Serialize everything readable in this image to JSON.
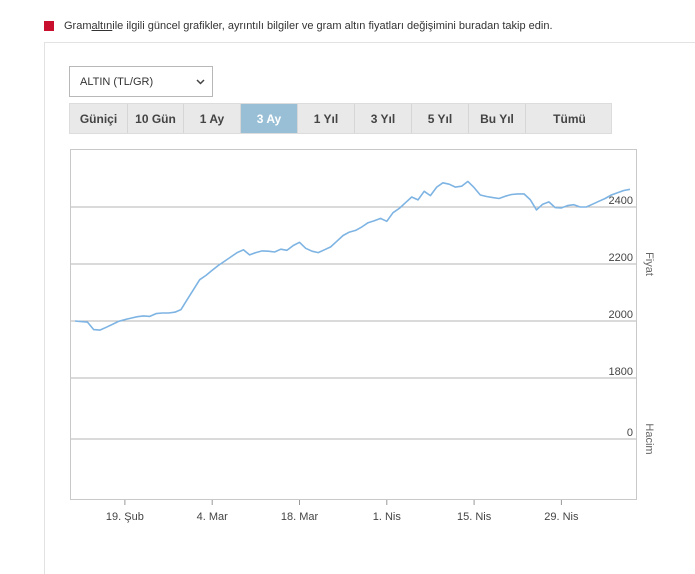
{
  "info": {
    "before": "Gram ",
    "link": "altın",
    "after": " ile ilgili güncel grafikler, ayrıntılı bilgiler ve gram altın fiyatları değişimini buradan takip edin."
  },
  "selector": {
    "value": "ALTIN (TL/GR)",
    "icon": "chevron-down-icon"
  },
  "tabs": [
    {
      "label": "Güniçi",
      "active": false
    },
    {
      "label": "10 Gün",
      "active": false
    },
    {
      "label": "1 Ay",
      "active": false
    },
    {
      "label": "3 Ay",
      "active": true
    },
    {
      "label": "1 Yıl",
      "active": false
    },
    {
      "label": "3 Yıl",
      "active": false
    },
    {
      "label": "5 Yıl",
      "active": false
    },
    {
      "label": "Bu Yıl",
      "active": false
    },
    {
      "label": "Tümü",
      "active": false
    }
  ],
  "colors": {
    "accent": "#c8102e",
    "active_tab": "#99bfd6",
    "line": "#7eb4e3",
    "grid": "#b4b4b4"
  },
  "chart_data": {
    "type": "line",
    "price_label": "Fiyat",
    "volume_label": "Hacim",
    "price_ticks": [
      2400,
      2200,
      2000,
      1800
    ],
    "volume_ticks": [
      0
    ],
    "ylim": [
      1700,
      2550
    ],
    "x_ticks": [
      {
        "label": "19. Şub",
        "x": 8
      },
      {
        "label": "4. Mar",
        "x": 22
      },
      {
        "label": "18. Mar",
        "x": 36
      },
      {
        "label": "1. Nis",
        "x": 50
      },
      {
        "label": "15. Nis",
        "x": 64
      },
      {
        "label": "29. Nis",
        "x": 78
      }
    ],
    "xlim": [
      0,
      90
    ],
    "series": [
      {
        "x": [
          0,
          1,
          2,
          3,
          4,
          5,
          6,
          7,
          8,
          9,
          10,
          11,
          12,
          13,
          14,
          15,
          16,
          17,
          18,
          19,
          20,
          21,
          22,
          23,
          24,
          25,
          26,
          27,
          28,
          29,
          30,
          31,
          32,
          33,
          34,
          35,
          36,
          37,
          38,
          39,
          40,
          41,
          42,
          43,
          44,
          45,
          46,
          47,
          48,
          49,
          50,
          51,
          52,
          53,
          54,
          55,
          56,
          57,
          58,
          59,
          60,
          61,
          62,
          63,
          64,
          65,
          66,
          67,
          68,
          69,
          70,
          71,
          72,
          73,
          74,
          75,
          76,
          77,
          78,
          79,
          80,
          81,
          82,
          83,
          84,
          85,
          86,
          87,
          88,
          89
        ],
        "values": [
          2000,
          1998,
          1996,
          1970,
          1968,
          1978,
          1988,
          1999,
          2005,
          2010,
          2015,
          2018,
          2016,
          2026,
          2028,
          2028,
          2031,
          2040,
          2075,
          2110,
          2145,
          2160,
          2178,
          2195,
          2210,
          2225,
          2240,
          2250,
          2232,
          2240,
          2246,
          2245,
          2242,
          2252,
          2248,
          2265,
          2276,
          2255,
          2245,
          2240,
          2250,
          2260,
          2280,
          2300,
          2312,
          2318,
          2330,
          2345,
          2352,
          2360,
          2350,
          2380,
          2395,
          2415,
          2435,
          2425,
          2455,
          2440,
          2470,
          2485,
          2480,
          2470,
          2473,
          2490,
          2468,
          2442,
          2437,
          2433,
          2430,
          2438,
          2444,
          2446,
          2446,
          2426,
          2390,
          2410,
          2418,
          2398,
          2397,
          2405,
          2408,
          2400,
          2400,
          2410,
          2420,
          2430,
          2442,
          2450,
          2458,
          2462
        ]
      }
    ]
  }
}
